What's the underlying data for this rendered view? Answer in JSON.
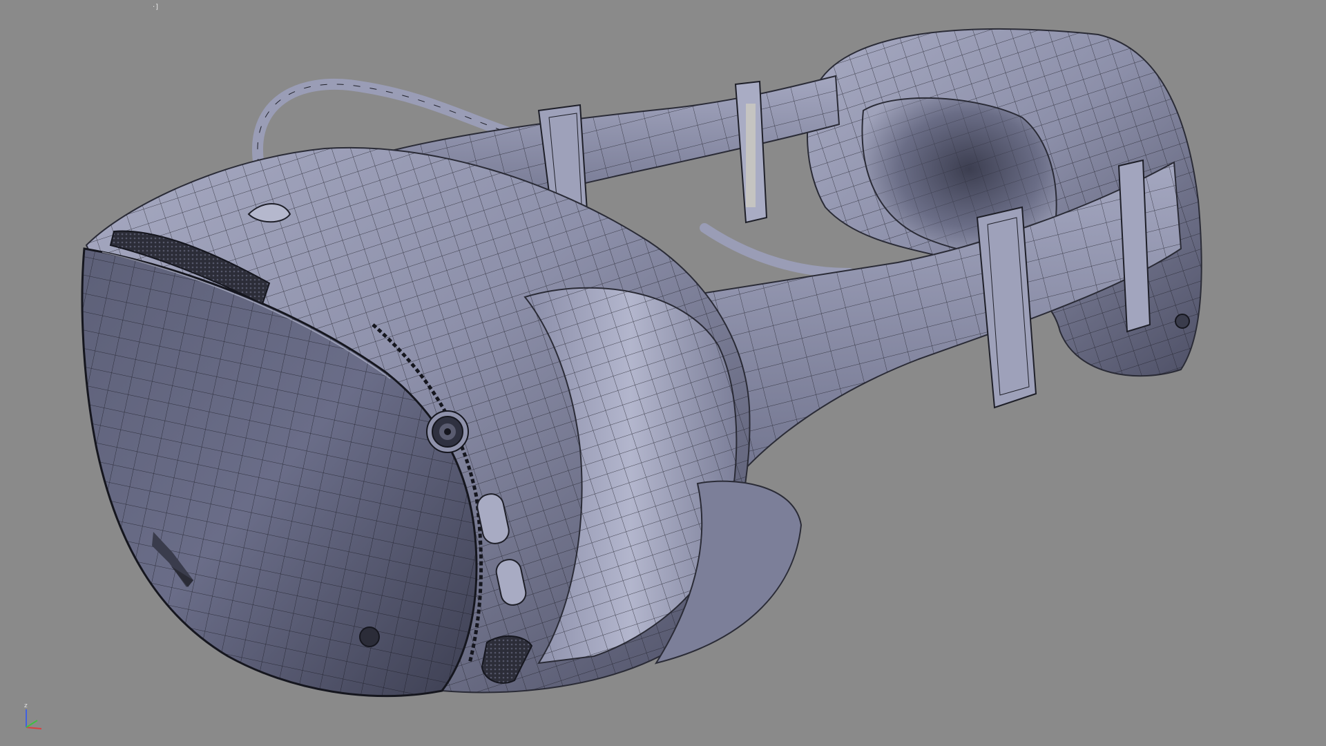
{
  "viewport": {
    "label": "·]",
    "background": "#8a8a8a",
    "shading": "shaded-with-wireframe",
    "object": "vr-headset"
  },
  "axis_gizmo": {
    "z_label": "z",
    "x_color": "#d84040",
    "y_color": "#40c040",
    "z_color": "#4060e0"
  },
  "model": {
    "base_color": "#8f93ae",
    "highlight_color": "#b9bcd2",
    "shadow_color": "#4a4c60",
    "wire_color": "#1e1f28"
  }
}
